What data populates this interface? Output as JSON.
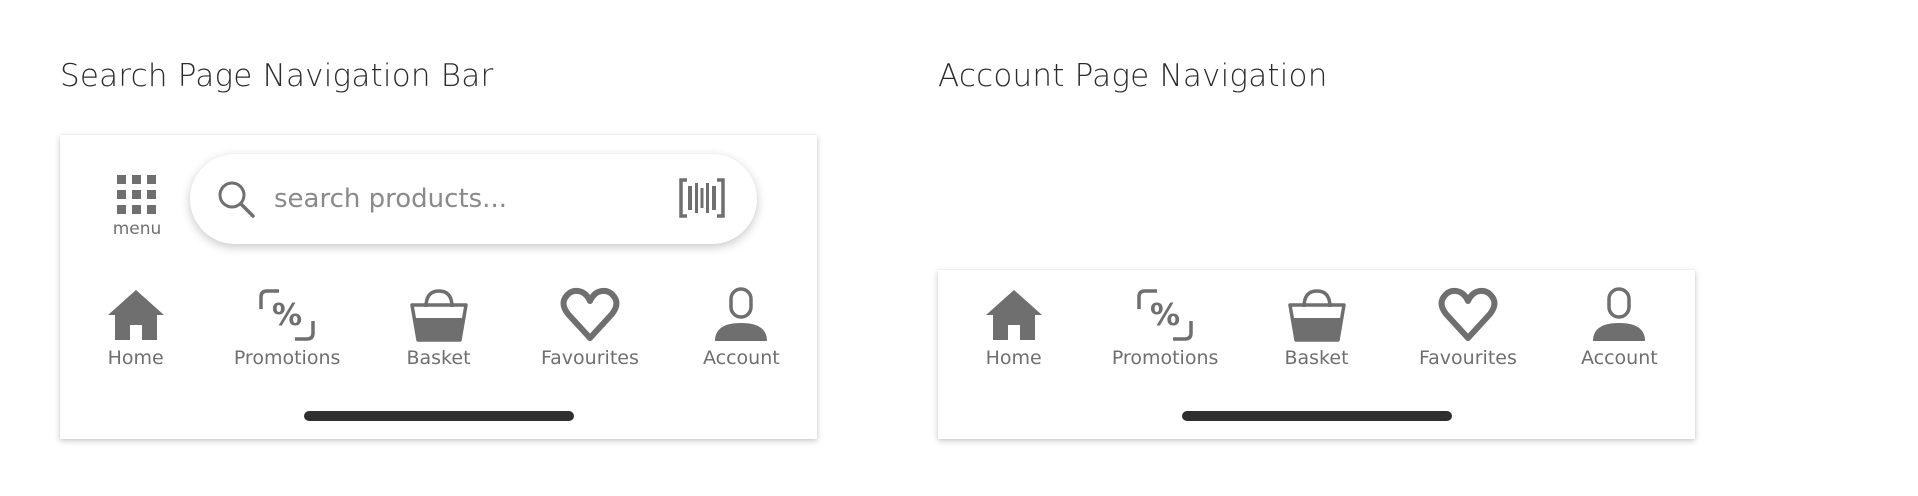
{
  "search_section": {
    "title": "Search Page Navigation Bar",
    "menu": {
      "label": "menu",
      "icon": "grid-icon"
    },
    "search": {
      "placeholder": "search products...",
      "icon": "search-icon",
      "scan_icon": "barcode-icon"
    },
    "nav_items": [
      {
        "label": "Home",
        "icon": "home-icon"
      },
      {
        "label": "Promotions",
        "icon": "percent-icon"
      },
      {
        "label": "Basket",
        "icon": "basket-icon"
      },
      {
        "label": "Favourites",
        "icon": "heart-icon"
      },
      {
        "label": "Account",
        "icon": "account-icon"
      }
    ]
  },
  "account_section": {
    "title": "Account Page Navigation",
    "nav_items": [
      {
        "label": "Home",
        "icon": "home-icon"
      },
      {
        "label": "Promotions",
        "icon": "percent-icon"
      },
      {
        "label": "Basket",
        "icon": "basket-icon"
      },
      {
        "label": "Favourites",
        "icon": "heart-icon"
      },
      {
        "label": "Account",
        "icon": "account-icon"
      }
    ]
  },
  "colors": {
    "icon": "#6f6f6f",
    "text": "#6f6f6f",
    "title": "#2b2b2b",
    "indicator": "#2f2f2f"
  }
}
